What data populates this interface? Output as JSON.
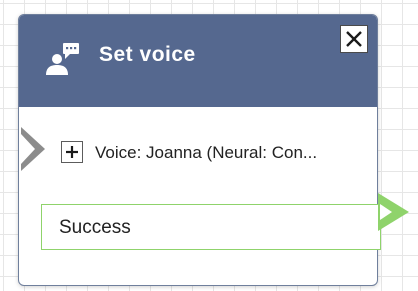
{
  "block": {
    "title": "Set voice",
    "header_color": "#55688f",
    "icon": "person-speech-icon",
    "close_icon": "close-icon"
  },
  "parameters": [
    {
      "text": "Voice: Joanna (Neural: Con..."
    }
  ],
  "branches": [
    {
      "label": "Success",
      "color": "#8fd36b"
    }
  ]
}
